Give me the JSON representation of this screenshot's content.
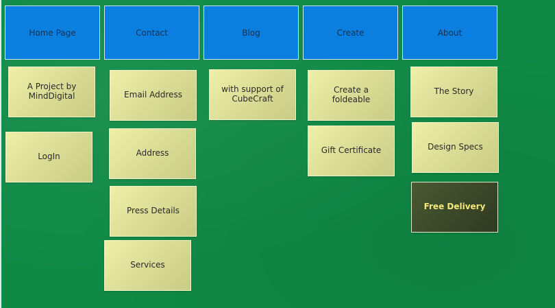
{
  "nav": [
    "Home Page",
    "Contact",
    "Blog",
    "Create",
    "About"
  ],
  "col1": [
    "A Project by MindDigital",
    "LogIn"
  ],
  "col2": [
    "Email Address",
    "Address",
    "Press Details",
    "Services"
  ],
  "col3": [
    "with support of CubeCraft"
  ],
  "col4": [
    "Create a foldeable",
    "Gift Certificate"
  ],
  "col5": [
    "The Story",
    "Design Specs",
    "Free Delivery"
  ],
  "colors": {
    "background": "#0f8a45",
    "nav": "#0a7fe0",
    "note": "#e4e6a0",
    "highlight_note": "#3a4628",
    "highlight_text": "#f2e97a"
  }
}
